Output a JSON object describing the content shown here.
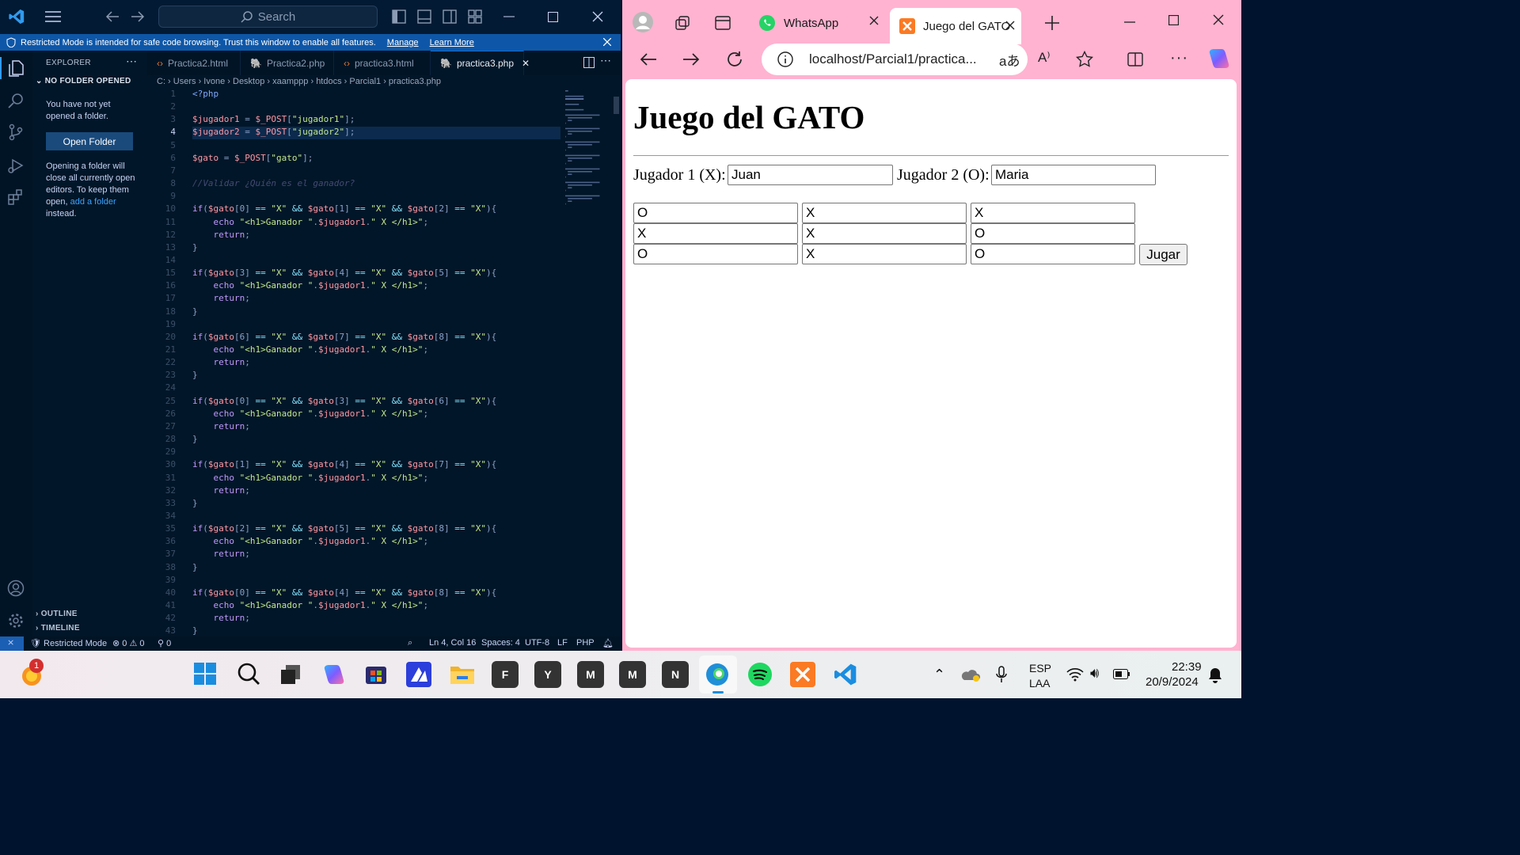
{
  "vscode": {
    "search_placeholder": "Search",
    "banner": {
      "text": "Restricted Mode is intended for safe code browsing. Trust this window to enable all features.",
      "manage": "Manage",
      "learn_more": "Learn More"
    },
    "explorer": {
      "title": "EXPLORER",
      "section": "NO FOLDER OPENED",
      "msg1": "You have not yet opened a folder.",
      "open_folder": "Open Folder",
      "msg2a": "Opening a folder will close all currently open editors. To keep them open,",
      "msg2_link": "add a folder",
      "msg2b": "instead.",
      "outline": "OUTLINE",
      "timeline": "TIMELINE"
    },
    "tabs": [
      {
        "label": "Practica2.html",
        "icon": "html-icon"
      },
      {
        "label": "Practica2.php",
        "icon": "php-icon"
      },
      {
        "label": "practica3.html",
        "icon": "html-icon"
      },
      {
        "label": "practica3.php",
        "icon": "php-icon"
      }
    ],
    "breadcrumb": [
      "C:",
      "Users",
      "Ivone",
      "Desktop",
      "xaamppp",
      "htdocs",
      "Parcial1",
      "practica3.php"
    ],
    "code_lines": [
      "<?php",
      "",
      "$jugador1 = $_POST[\"jugador1\"];",
      "$jugador2 = $_POST[\"jugador2\"];",
      "",
      "$gato = $_POST[\"gato\"];",
      "",
      "//Validar ¿Quién es el ganador?",
      "",
      "if($gato[0] == \"X\" && $gato[1] == \"X\" && $gato[2] == \"X\"){",
      "    echo \"<h1>Ganador \".$jugador1.\" X </h1>\";",
      "    return;",
      "}",
      "",
      "if($gato[3] == \"X\" && $gato[4] == \"X\" && $gato[5] == \"X\"){",
      "    echo \"<h1>Ganador \".$jugador1.\" X </h1>\";",
      "    return;",
      "}",
      "",
      "if($gato[6] == \"X\" && $gato[7] == \"X\" && $gato[8] == \"X\"){",
      "    echo \"<h1>Ganador \".$jugador1.\" X </h1>\";",
      "    return;",
      "}",
      "",
      "if($gato[0] == \"X\" && $gato[3] == \"X\" && $gato[6] == \"X\"){",
      "    echo \"<h1>Ganador \".$jugador1.\" X </h1>\";",
      "    return;",
      "}",
      "",
      "if($gato[1] == \"X\" && $gato[4] == \"X\" && $gato[7] == \"X\"){",
      "    echo \"<h1>Ganador \".$jugador1.\" X </h1>\";",
      "    return;",
      "}",
      "",
      "if($gato[2] == \"X\" && $gato[5] == \"X\" && $gato[8] == \"X\"){",
      "    echo \"<h1>Ganador \".$jugador1.\" X </h1>\";",
      "    return;",
      "}",
      "",
      "if($gato[0] == \"X\" && $gato[4] == \"X\" && $gato[8] == \"X\"){",
      "    echo \"<h1>Ganador \".$jugador1.\" X </h1>\";",
      "    return;",
      "}"
    ],
    "status": {
      "mode": "Restricted Mode",
      "problems": "0 ⚠ 0",
      "ports": "0",
      "position": "Ln 4, Col 16",
      "spaces": "Spaces: 4",
      "encoding": "UTF-8",
      "eol": "LF",
      "language": "PHP"
    }
  },
  "edge": {
    "tabs": [
      {
        "label": "WhatsApp",
        "icon": "whatsapp-icon"
      },
      {
        "label": "Juego del GATO",
        "icon": "xampp-icon"
      }
    ],
    "url": "localhost/Parcial1/practica...",
    "page": {
      "title": "Juego del GATO",
      "player1_label": "Jugador 1 (X):",
      "player1_value": "Juan",
      "player2_label": "Jugador 2 (O):",
      "player2_value": "Maria",
      "board": [
        "O",
        "X",
        "X",
        "X",
        "X",
        "O",
        "O",
        "X",
        "O"
      ],
      "play_button": "Jugar"
    }
  },
  "taskbar": {
    "notification_badge": "1",
    "pinned_letters": [
      "F",
      "Y",
      "M",
      "M",
      "N"
    ],
    "lang": "ESP",
    "layout": "LAA",
    "time": "22:39",
    "date": "20/9/2024"
  }
}
